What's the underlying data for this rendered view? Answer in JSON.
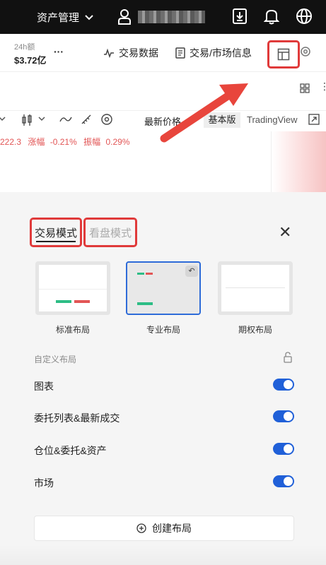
{
  "topbar": {
    "asset_mgmt_label": "资产管理",
    "icons": [
      "chevron-down-icon",
      "user-icon",
      "download-icon",
      "bell-icon",
      "globe-icon"
    ]
  },
  "bar2": {
    "volume_label": "24h额",
    "volume_value": "$3.72亿",
    "more": "···",
    "trade_data_label": "交易数据",
    "market_info_label": "交易/市场信息"
  },
  "chart": {
    "latest_price_label": "最新价格",
    "basic_version_label": "基本版",
    "tradingview_label": "TradingView",
    "price_fragment": "222.3",
    "change_label": "涨幅",
    "change_value": "-0.21%",
    "amplitude_label": "振幅",
    "amplitude_value": "0.29%"
  },
  "panel": {
    "tab_trade_mode": "交易模式",
    "tab_view_mode": "看盘模式",
    "layouts": [
      {
        "label": "标准布局"
      },
      {
        "label": "专业布局",
        "selected": true
      },
      {
        "label": "期权布局"
      }
    ],
    "custom_layout_label": "自定义布局",
    "toggles": [
      {
        "label": "图表",
        "on": true
      },
      {
        "label": "委托列表&最新成交",
        "on": true
      },
      {
        "label": "仓位&委托&资产",
        "on": true
      },
      {
        "label": "市场",
        "on": true
      }
    ],
    "create_layout_label": "创建布局"
  },
  "colors": {
    "accent_blue": "#2060d8",
    "highlight_red": "#e03a3a",
    "down_red": "#e25555",
    "up_green": "#2dbd85"
  }
}
